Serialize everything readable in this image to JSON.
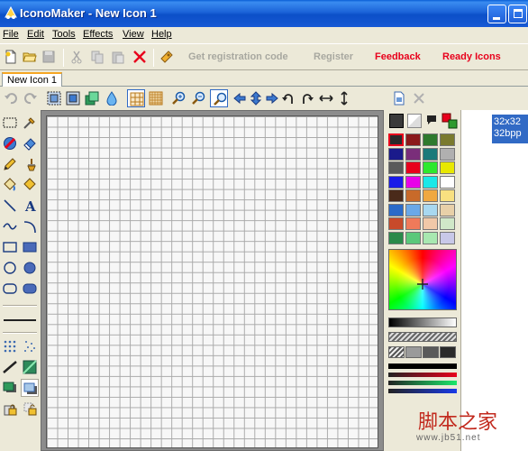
{
  "window": {
    "title": "IconoMaker - New Icon 1"
  },
  "menu": [
    {
      "label": "File"
    },
    {
      "label": "Edit"
    },
    {
      "label": "Tools"
    },
    {
      "label": "Effects"
    },
    {
      "label": "View"
    },
    {
      "label": "Help"
    }
  ],
  "toolbar": {
    "get_registration_code": "Get registration code",
    "register": "Register",
    "feedback": "Feedback",
    "ready_icons": "Ready Icons"
  },
  "tabs": {
    "active": "New Icon 1"
  },
  "canvas": {
    "grid_size": 32
  },
  "formats": [
    {
      "size": "32x32",
      "depth": "32bpp"
    }
  ],
  "colors": {
    "foreground": "#3a3a3a",
    "background": "#ffffff",
    "swatches": [
      "#2a2a2a",
      "#8b1a1a",
      "#2e7a2e",
      "#7a7a2e",
      "#1a1a8b",
      "#7a2e7a",
      "#1a7a7a",
      "#b0b0b0",
      "#5a5a5a",
      "#e8001c",
      "#2ee82e",
      "#e8e800",
      "#1a1ae8",
      "#e800e8",
      "#1ae8e8",
      "#ffffff",
      "#4a2a1a",
      "#c86a2a",
      "#f0a840",
      "#f8e080",
      "#2a6ac8",
      "#6aa8e8",
      "#a8d8f0",
      "#e8d0a8",
      "#c84a2a",
      "#f07a5a",
      "#f0c8a8",
      "#d0e8c8",
      "#2a8a4a",
      "#5ac87a",
      "#a8e8b0",
      "#c8c8e8"
    ]
  },
  "watermark": {
    "main": "脚本之家",
    "sub": "www.jb51.net"
  }
}
